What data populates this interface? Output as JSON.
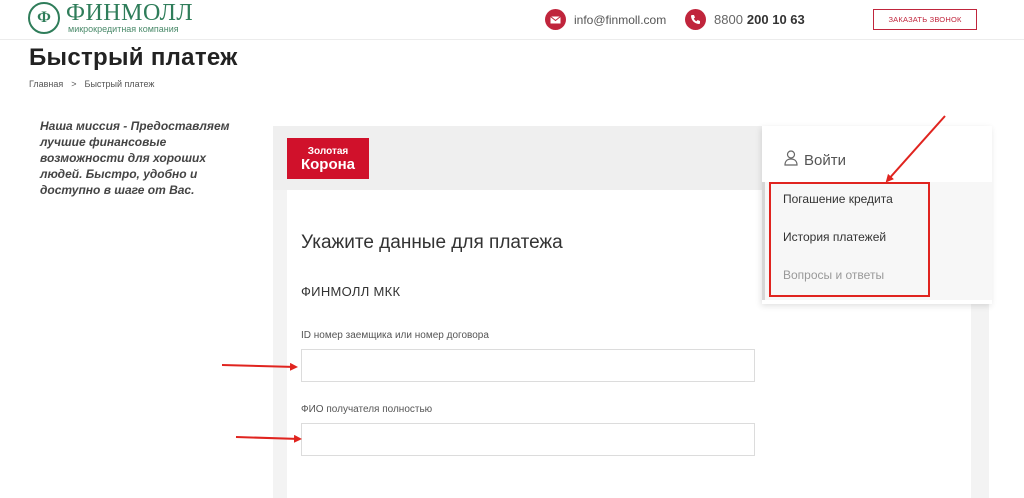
{
  "header": {
    "logo_mark": "Ф",
    "logo_name": "ФИНМОЛЛ",
    "logo_subtitle": "микрокредитная компания",
    "email": "info@finmoll.com",
    "phone_prefix": "8800",
    "phone_main": "200 10 63",
    "callback_label": "ЗАКАЗАТЬ ЗВОНОК"
  },
  "page": {
    "title": "Быстрый платеж",
    "breadcrumb": [
      "Главная",
      "Быстрый платеж"
    ],
    "breadcrumb_separator": ">",
    "mission": "Наша миссия - Предоставляем лучшие финансовые возможности для хороших людей. Быстро, удобно и доступно в шаге от Вас."
  },
  "payment": {
    "brand_line1": "Золотая",
    "brand_line2": "Корона",
    "title": "Укажите данные для платежа",
    "company": "ФИНМОЛЛ МКК",
    "fields": [
      {
        "label": "ID номер заемщика или номер договора",
        "value": ""
      },
      {
        "label": "ФИО получателя полностью",
        "value": ""
      }
    ]
  },
  "menu": {
    "login_label": "Войти",
    "items": [
      {
        "label": "Погашение кредита",
        "muted": false
      },
      {
        "label": "История платежей",
        "muted": false
      },
      {
        "label": "Вопросы и ответы",
        "muted": true
      }
    ]
  },
  "colors": {
    "brand_green": "#2f7d5a",
    "accent_red": "#c0253c",
    "annotation_red": "#e0241f",
    "korona_red": "#d0112b"
  },
  "icons": {
    "email": "envelope-icon",
    "phone": "phone-icon",
    "login": "user-icon",
    "annotation": "arrow-icon"
  }
}
